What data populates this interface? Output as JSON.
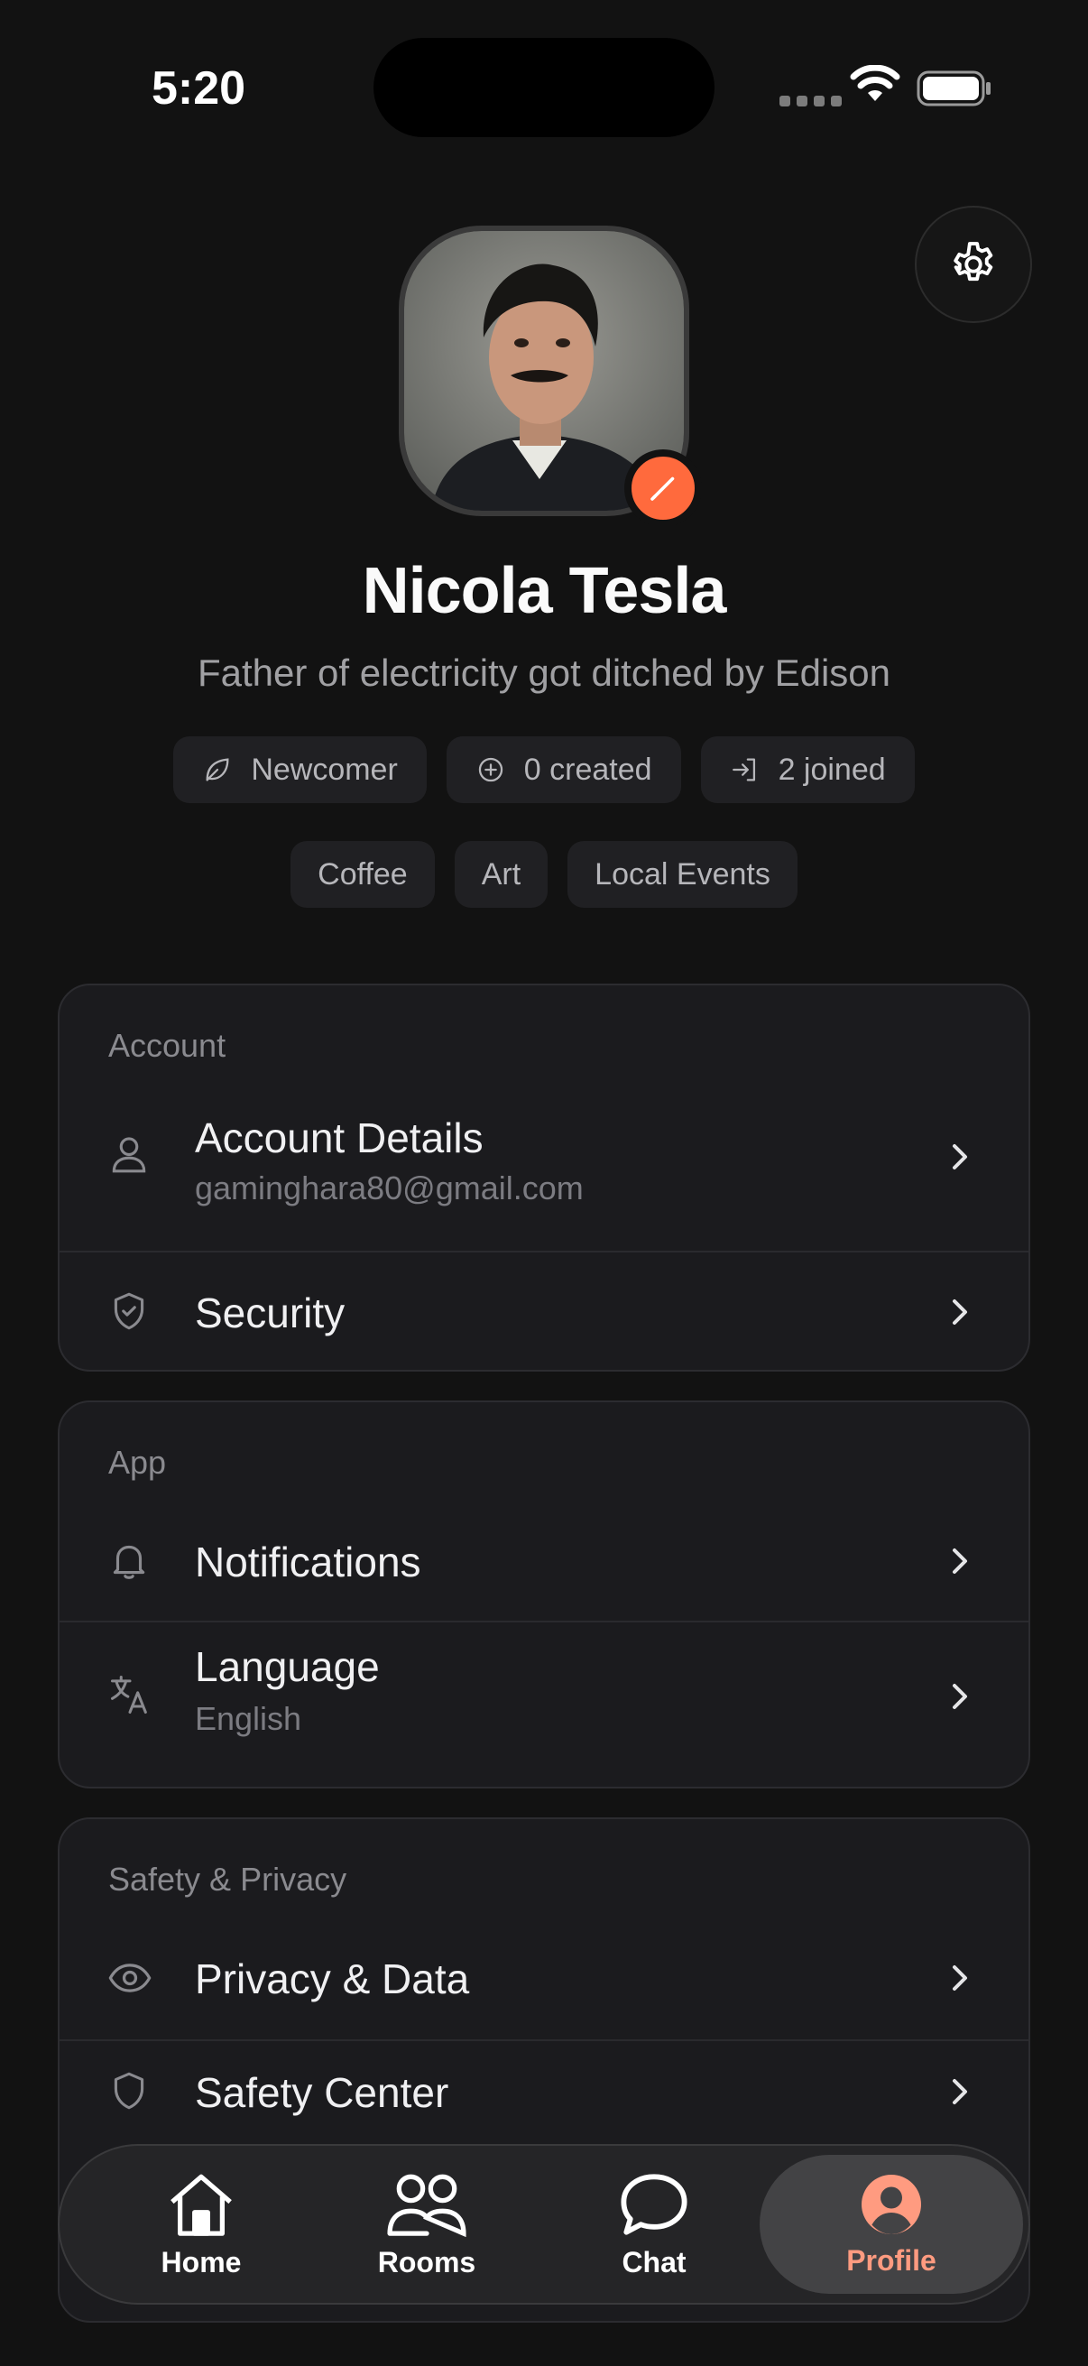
{
  "status_bar": {
    "time": "5:20"
  },
  "profile": {
    "name": "Nicola Tesla",
    "bio": "Father of electricity got ditched by Edison"
  },
  "stats": [
    {
      "label": "Newcomer",
      "icon": "leaf-icon"
    },
    {
      "label": "0 created",
      "icon": "plus-circle-icon"
    },
    {
      "label": "2 joined",
      "icon": "sign-in-icon"
    }
  ],
  "interests": [
    "Coffee",
    "Art",
    "Local Events"
  ],
  "account": {
    "title": "Account",
    "details_label": "Account Details",
    "details_email": "gaminghara80@gmail.com",
    "security_label": "Security"
  },
  "app": {
    "title": "App",
    "notifications_label": "Notifications",
    "language_label": "Language",
    "language_value": "English"
  },
  "safety": {
    "title": "Safety & Privacy",
    "privacy_label": "Privacy & Data",
    "safety_center_label": "Safety Center"
  },
  "tabs": [
    {
      "label": "Home",
      "icon": "home-icon"
    },
    {
      "label": "Rooms",
      "icon": "users-icon"
    },
    {
      "label": "Chat",
      "icon": "chat-bubble-icon"
    },
    {
      "label": "Profile",
      "icon": "profile-icon",
      "active": true
    }
  ],
  "colors": {
    "accent": "#ff6a3d",
    "active_tab_text": "#ff9b80",
    "background": "#121212",
    "card": "#1b1b1e"
  }
}
